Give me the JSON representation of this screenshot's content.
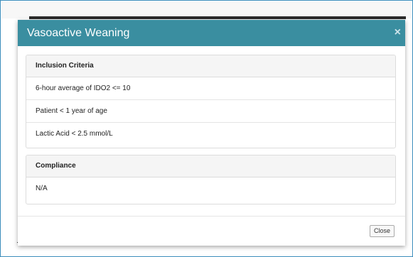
{
  "modal": {
    "title": "Vasoactive Weaning",
    "close_icon_glyph": "×",
    "header_color": "#3a8ea0"
  },
  "inclusion": {
    "heading": "Inclusion Criteria",
    "items": [
      "6-hour average of IDO2 <= 10",
      "Patient < 1 year of age",
      "Lactic Acid < 2.5 mmol/L"
    ]
  },
  "compliance": {
    "heading": "Compliance",
    "items": [
      "N/A"
    ]
  },
  "footer": {
    "close_label": "Close"
  }
}
